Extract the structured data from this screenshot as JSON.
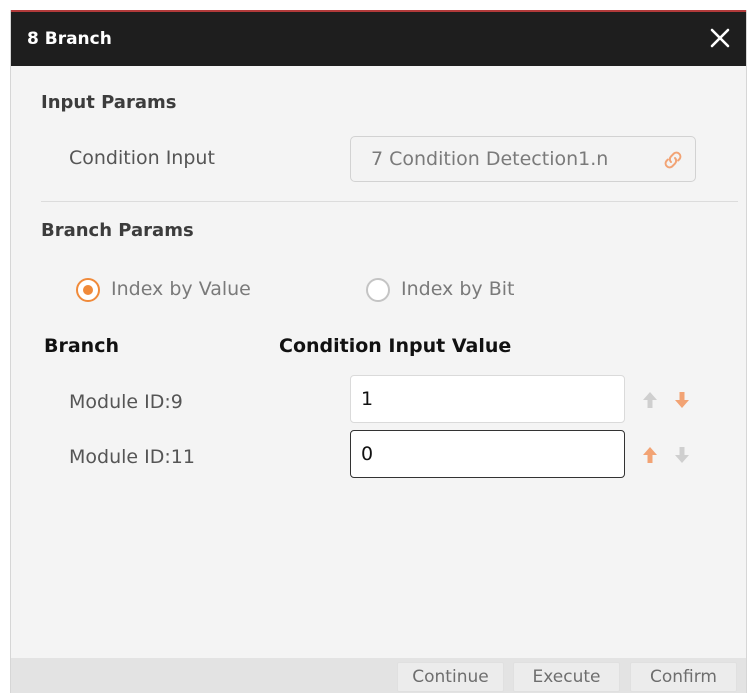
{
  "dialog": {
    "title": "8 Branch",
    "close_icon": "close-icon"
  },
  "input_params": {
    "title": "Input Params",
    "condition_input_label": "Condition Input",
    "condition_input_value": "7 Condition Detection1.n",
    "link_icon": "link-icon"
  },
  "branch_params": {
    "title": "Branch Params",
    "options": [
      {
        "label": "Index by Value",
        "selected": true
      },
      {
        "label": "Index by Bit",
        "selected": false
      }
    ]
  },
  "table": {
    "branch_header": "Branch",
    "value_header": "Condition Input Value",
    "rows": [
      {
        "module": "Module ID:9",
        "value": "1",
        "up_enabled": false,
        "down_enabled": true
      },
      {
        "module": "Module ID:11",
        "value": "0",
        "up_enabled": true,
        "down_enabled": false
      }
    ]
  },
  "footer": {
    "continue_label": "Continue",
    "execute_label": "Execute",
    "confirm_label": "Confirm"
  },
  "colors": {
    "accent": "#f08a3a",
    "titlebar": "#1e1e1e",
    "arrow_disabled": "#cfcfcf"
  }
}
